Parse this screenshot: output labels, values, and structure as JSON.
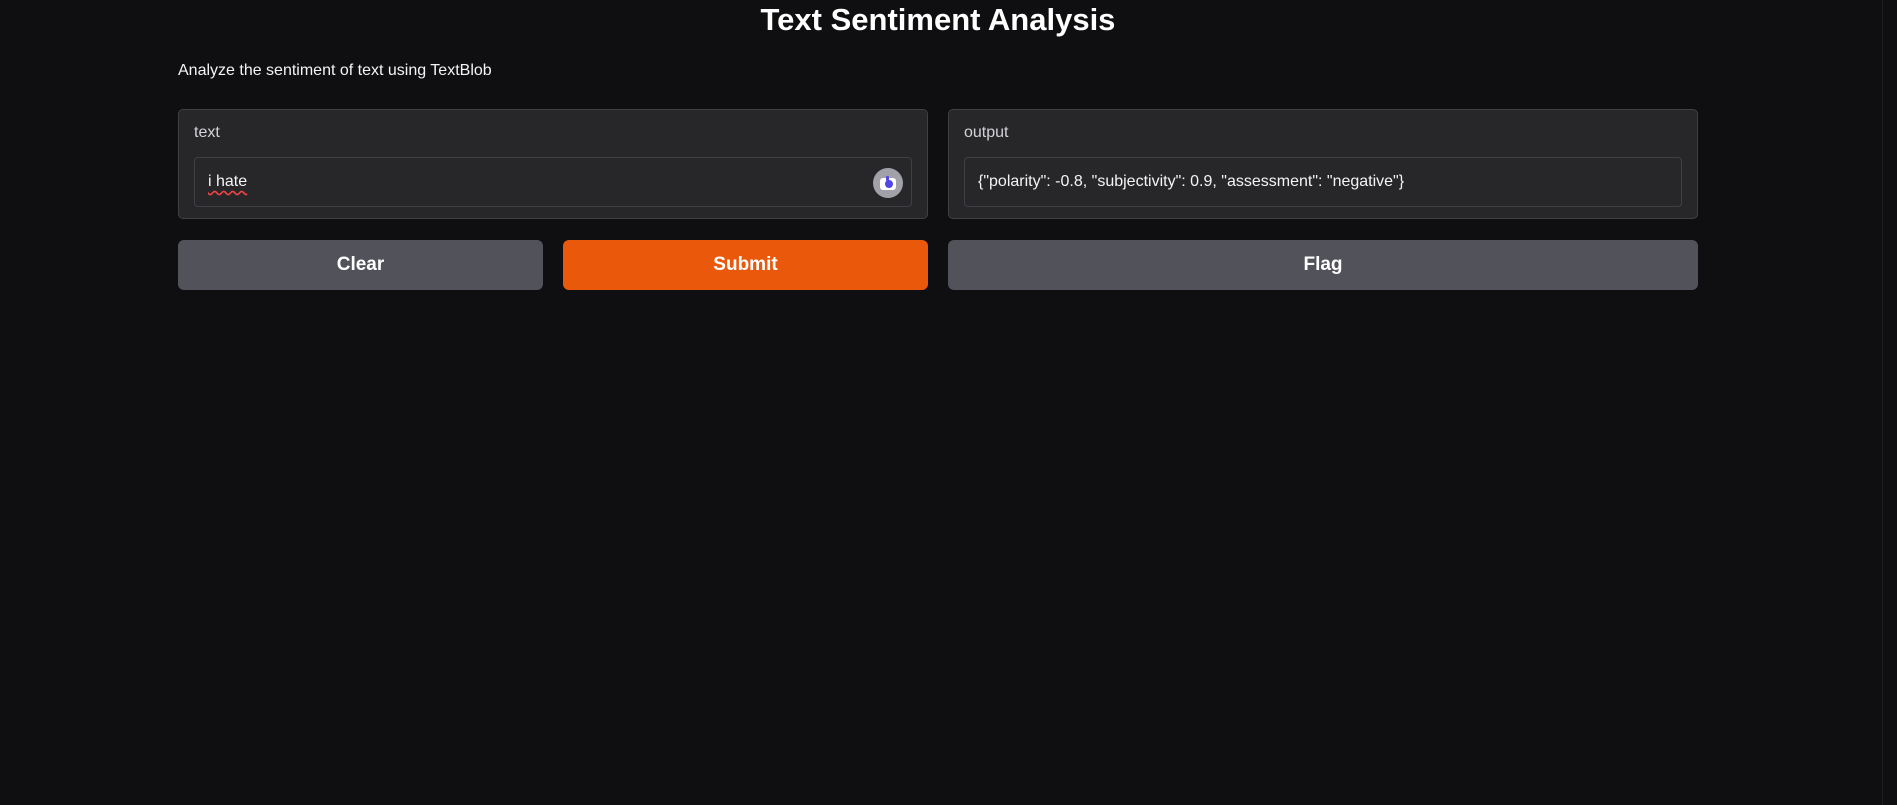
{
  "header": {
    "title": "Text Sentiment Analysis",
    "description": "Analyze the sentiment of text using TextBlob"
  },
  "input_panel": {
    "label": "text",
    "value": "i hate",
    "extension_icon": "grammar-extension-icon"
  },
  "output_panel": {
    "label": "output",
    "value": "{\"polarity\": -0.8, \"subjectivity\": 0.9, \"assessment\": \"negative\"}"
  },
  "buttons": {
    "clear_label": "Clear",
    "submit_label": "Submit",
    "flag_label": "Flag"
  },
  "colors": {
    "background": "#0f0f11",
    "panel": "#27272a",
    "primary_button": "#ea580c",
    "secondary_button": "#52525b"
  }
}
